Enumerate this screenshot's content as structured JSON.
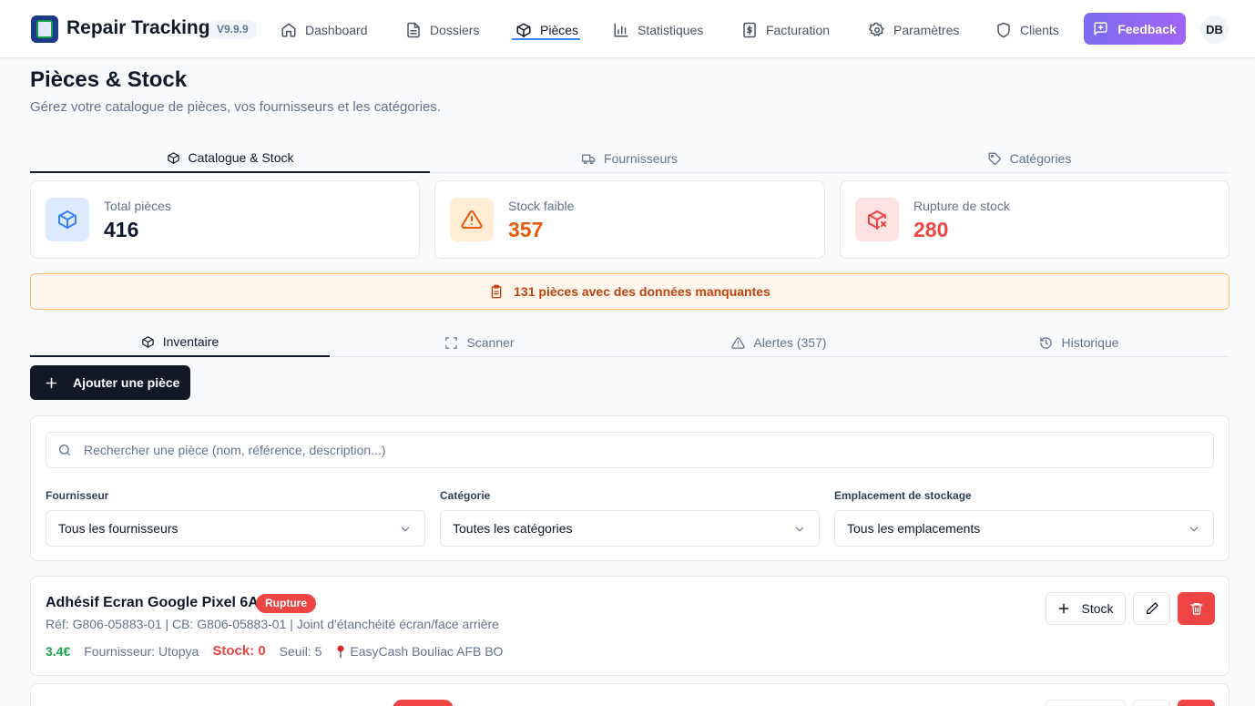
{
  "app": {
    "title": "Repair Tracking",
    "version": "V9.9.9"
  },
  "nav": {
    "items": [
      {
        "label": "Dashboard",
        "icon": "home-icon"
      },
      {
        "label": "Dossiers",
        "icon": "file-icon"
      },
      {
        "label": "Pièces",
        "icon": "package-icon",
        "active": true
      },
      {
        "label": "Statistiques",
        "icon": "bar-chart-icon"
      },
      {
        "label": "Facturation",
        "icon": "dollar-file-icon"
      },
      {
        "label": "Paramètres",
        "icon": "gear-icon"
      },
      {
        "label": "Clients",
        "icon": "shield-icon"
      }
    ],
    "feedback_label": "Feedback",
    "avatar_initials": "DB"
  },
  "page": {
    "title": "Pièces & Stock",
    "subtitle": "Gérez votre catalogue de pièces, vos fournisseurs et les catégories."
  },
  "main_tabs": [
    {
      "label": "Catalogue & Stock",
      "active": true
    },
    {
      "label": "Fournisseurs"
    },
    {
      "label": "Catégories"
    }
  ],
  "stats": {
    "total": {
      "label": "Total pièces",
      "value": "416",
      "color": "#0f172a"
    },
    "low": {
      "label": "Stock faible",
      "value": "357",
      "color": "#ea580c"
    },
    "out": {
      "label": "Rupture de stock",
      "value": "280",
      "color": "#ef4444"
    }
  },
  "banner": {
    "text": "131 pièces avec des données manquantes"
  },
  "sub_tabs": [
    {
      "label": "Inventaire",
      "active": true
    },
    {
      "label": "Scanner"
    },
    {
      "label": "Alertes (357)"
    },
    {
      "label": "Historique"
    }
  ],
  "actions": {
    "add_part": "Ajouter une pièce"
  },
  "filters": {
    "search_placeholder": "Rechercher une pièce (nom, référence, description...)",
    "supplier": {
      "label": "Fournisseur",
      "value": "Tous les fournisseurs"
    },
    "category": {
      "label": "Catégorie",
      "value": "Toutes les catégories"
    },
    "location": {
      "label": "Emplacement de stockage",
      "value": "Tous les emplacements"
    }
  },
  "parts": [
    {
      "name": "Adhésif Ecran Google Pixel 6A",
      "badge": "Rupture",
      "ref_line": "Réf: G806-05883-01 | CB: G806-05883-01 | Joint d'étanchéité écran/face arrière",
      "price": "3.4€",
      "supplier": "Fournisseur: Utopya",
      "stock": "Stock: 0",
      "threshold": "Seuil: 5",
      "location": "EasyCash Bouliac AFB BO",
      "stock_button": "Stock"
    }
  ],
  "colors": {
    "accent": "#3b82f6",
    "feedback": "#8b5cf6",
    "danger": "#ef4444",
    "warning": "#ea580c",
    "success": "#16a34a"
  }
}
